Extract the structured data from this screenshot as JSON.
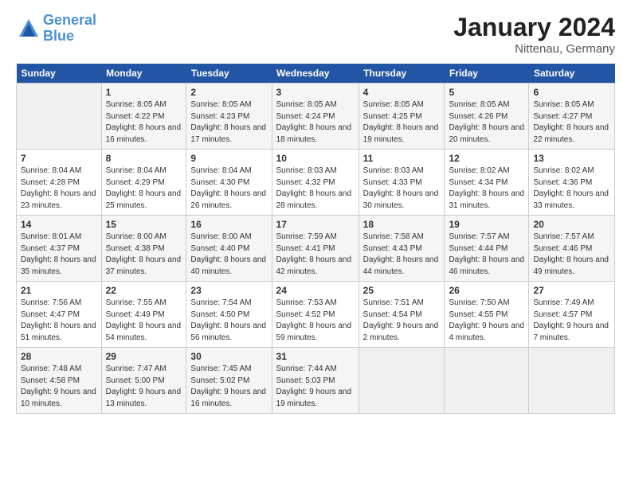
{
  "header": {
    "logo_line1": "General",
    "logo_line2": "Blue",
    "title": "January 2024",
    "subtitle": "Nittenau, Germany"
  },
  "days_of_week": [
    "Sunday",
    "Monday",
    "Tuesday",
    "Wednesday",
    "Thursday",
    "Friday",
    "Saturday"
  ],
  "weeks": [
    [
      {
        "day": "",
        "sunrise": "",
        "sunset": "",
        "daylight": ""
      },
      {
        "day": "1",
        "sunrise": "Sunrise: 8:05 AM",
        "sunset": "Sunset: 4:22 PM",
        "daylight": "Daylight: 8 hours and 16 minutes."
      },
      {
        "day": "2",
        "sunrise": "Sunrise: 8:05 AM",
        "sunset": "Sunset: 4:23 PM",
        "daylight": "Daylight: 8 hours and 17 minutes."
      },
      {
        "day": "3",
        "sunrise": "Sunrise: 8:05 AM",
        "sunset": "Sunset: 4:24 PM",
        "daylight": "Daylight: 8 hours and 18 minutes."
      },
      {
        "day": "4",
        "sunrise": "Sunrise: 8:05 AM",
        "sunset": "Sunset: 4:25 PM",
        "daylight": "Daylight: 8 hours and 19 minutes."
      },
      {
        "day": "5",
        "sunrise": "Sunrise: 8:05 AM",
        "sunset": "Sunset: 4:26 PM",
        "daylight": "Daylight: 8 hours and 20 minutes."
      },
      {
        "day": "6",
        "sunrise": "Sunrise: 8:05 AM",
        "sunset": "Sunset: 4:27 PM",
        "daylight": "Daylight: 8 hours and 22 minutes."
      }
    ],
    [
      {
        "day": "7",
        "sunrise": "Sunrise: 8:04 AM",
        "sunset": "Sunset: 4:28 PM",
        "daylight": "Daylight: 8 hours and 23 minutes."
      },
      {
        "day": "8",
        "sunrise": "Sunrise: 8:04 AM",
        "sunset": "Sunset: 4:29 PM",
        "daylight": "Daylight: 8 hours and 25 minutes."
      },
      {
        "day": "9",
        "sunrise": "Sunrise: 8:04 AM",
        "sunset": "Sunset: 4:30 PM",
        "daylight": "Daylight: 8 hours and 26 minutes."
      },
      {
        "day": "10",
        "sunrise": "Sunrise: 8:03 AM",
        "sunset": "Sunset: 4:32 PM",
        "daylight": "Daylight: 8 hours and 28 minutes."
      },
      {
        "day": "11",
        "sunrise": "Sunrise: 8:03 AM",
        "sunset": "Sunset: 4:33 PM",
        "daylight": "Daylight: 8 hours and 30 minutes."
      },
      {
        "day": "12",
        "sunrise": "Sunrise: 8:02 AM",
        "sunset": "Sunset: 4:34 PM",
        "daylight": "Daylight: 8 hours and 31 minutes."
      },
      {
        "day": "13",
        "sunrise": "Sunrise: 8:02 AM",
        "sunset": "Sunset: 4:36 PM",
        "daylight": "Daylight: 8 hours and 33 minutes."
      }
    ],
    [
      {
        "day": "14",
        "sunrise": "Sunrise: 8:01 AM",
        "sunset": "Sunset: 4:37 PM",
        "daylight": "Daylight: 8 hours and 35 minutes."
      },
      {
        "day": "15",
        "sunrise": "Sunrise: 8:00 AM",
        "sunset": "Sunset: 4:38 PM",
        "daylight": "Daylight: 8 hours and 37 minutes."
      },
      {
        "day": "16",
        "sunrise": "Sunrise: 8:00 AM",
        "sunset": "Sunset: 4:40 PM",
        "daylight": "Daylight: 8 hours and 40 minutes."
      },
      {
        "day": "17",
        "sunrise": "Sunrise: 7:59 AM",
        "sunset": "Sunset: 4:41 PM",
        "daylight": "Daylight: 8 hours and 42 minutes."
      },
      {
        "day": "18",
        "sunrise": "Sunrise: 7:58 AM",
        "sunset": "Sunset: 4:43 PM",
        "daylight": "Daylight: 8 hours and 44 minutes."
      },
      {
        "day": "19",
        "sunrise": "Sunrise: 7:57 AM",
        "sunset": "Sunset: 4:44 PM",
        "daylight": "Daylight: 8 hours and 46 minutes."
      },
      {
        "day": "20",
        "sunrise": "Sunrise: 7:57 AM",
        "sunset": "Sunset: 4:46 PM",
        "daylight": "Daylight: 8 hours and 49 minutes."
      }
    ],
    [
      {
        "day": "21",
        "sunrise": "Sunrise: 7:56 AM",
        "sunset": "Sunset: 4:47 PM",
        "daylight": "Daylight: 8 hours and 51 minutes."
      },
      {
        "day": "22",
        "sunrise": "Sunrise: 7:55 AM",
        "sunset": "Sunset: 4:49 PM",
        "daylight": "Daylight: 8 hours and 54 minutes."
      },
      {
        "day": "23",
        "sunrise": "Sunrise: 7:54 AM",
        "sunset": "Sunset: 4:50 PM",
        "daylight": "Daylight: 8 hours and 56 minutes."
      },
      {
        "day": "24",
        "sunrise": "Sunrise: 7:53 AM",
        "sunset": "Sunset: 4:52 PM",
        "daylight": "Daylight: 8 hours and 59 minutes."
      },
      {
        "day": "25",
        "sunrise": "Sunrise: 7:51 AM",
        "sunset": "Sunset: 4:54 PM",
        "daylight": "Daylight: 9 hours and 2 minutes."
      },
      {
        "day": "26",
        "sunrise": "Sunrise: 7:50 AM",
        "sunset": "Sunset: 4:55 PM",
        "daylight": "Daylight: 9 hours and 4 minutes."
      },
      {
        "day": "27",
        "sunrise": "Sunrise: 7:49 AM",
        "sunset": "Sunset: 4:57 PM",
        "daylight": "Daylight: 9 hours and 7 minutes."
      }
    ],
    [
      {
        "day": "28",
        "sunrise": "Sunrise: 7:48 AM",
        "sunset": "Sunset: 4:58 PM",
        "daylight": "Daylight: 9 hours and 10 minutes."
      },
      {
        "day": "29",
        "sunrise": "Sunrise: 7:47 AM",
        "sunset": "Sunset: 5:00 PM",
        "daylight": "Daylight: 9 hours and 13 minutes."
      },
      {
        "day": "30",
        "sunrise": "Sunrise: 7:45 AM",
        "sunset": "Sunset: 5:02 PM",
        "daylight": "Daylight: 9 hours and 16 minutes."
      },
      {
        "day": "31",
        "sunrise": "Sunrise: 7:44 AM",
        "sunset": "Sunset: 5:03 PM",
        "daylight": "Daylight: 9 hours and 19 minutes."
      },
      {
        "day": "",
        "sunrise": "",
        "sunset": "",
        "daylight": ""
      },
      {
        "day": "",
        "sunrise": "",
        "sunset": "",
        "daylight": ""
      },
      {
        "day": "",
        "sunrise": "",
        "sunset": "",
        "daylight": ""
      }
    ]
  ]
}
